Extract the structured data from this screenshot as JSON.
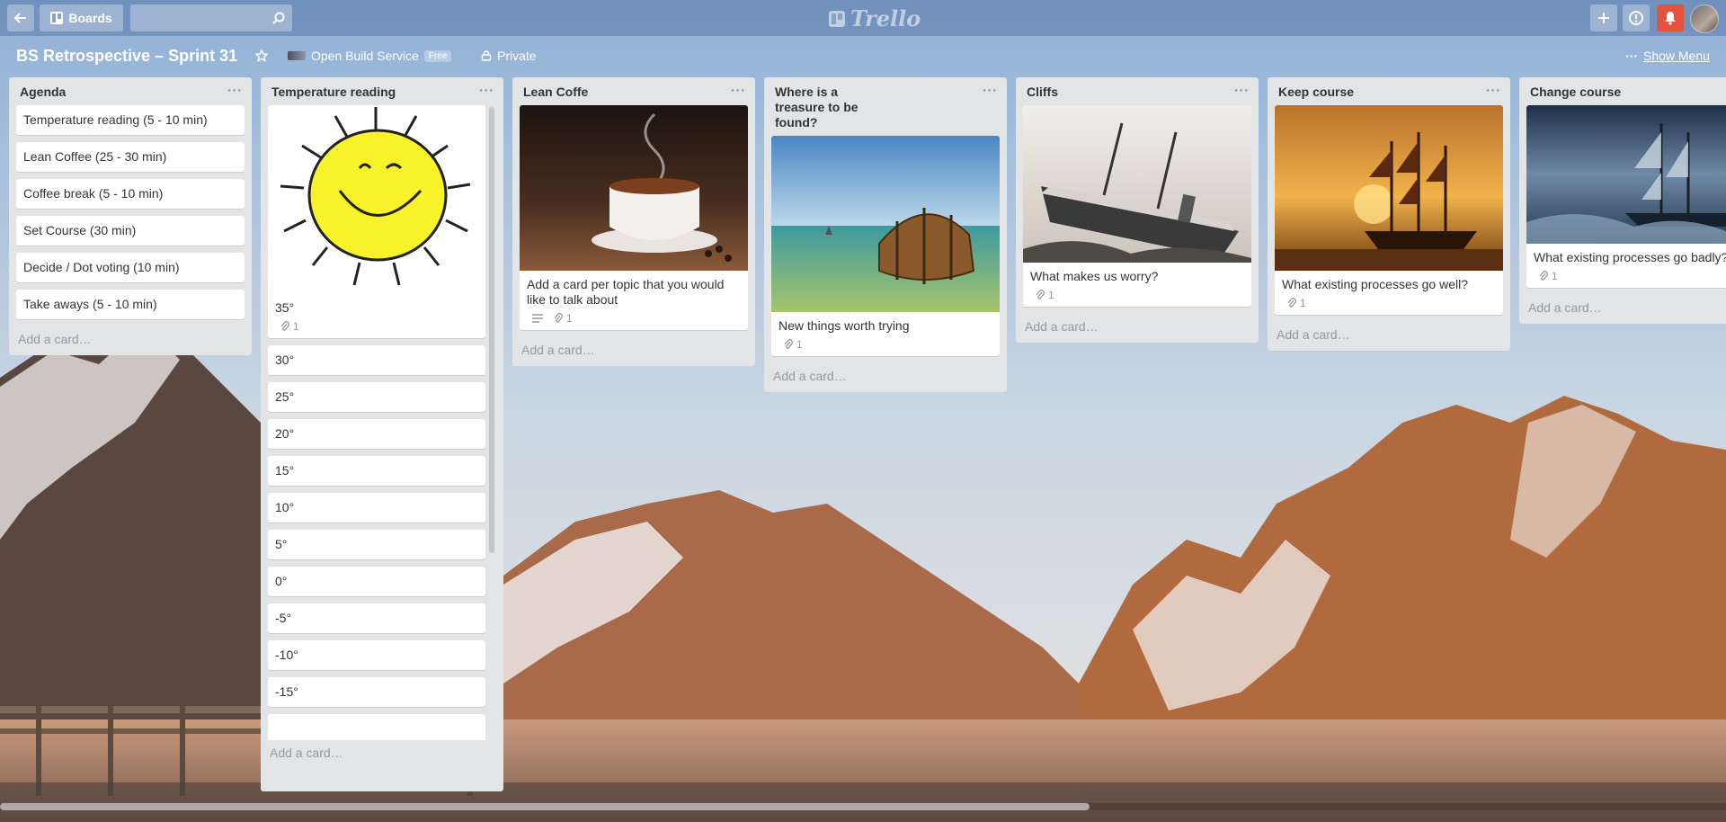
{
  "topbar": {
    "boards_label": "Boards",
    "logo_text": "Trello",
    "search_placeholder": ""
  },
  "board": {
    "title": "BS Retrospective – Sprint 31",
    "org_name": "Open Build Service",
    "org_badge": "Free",
    "visibility": "Private",
    "show_menu": "Show Menu"
  },
  "lists": {
    "agenda": {
      "title": "Agenda",
      "cards": [
        "Temperature reading (5 - 10 min)",
        "Lean Coffee (25 - 30 min)",
        "Coffee break (5 - 10 min)",
        "Set Course (30 min)",
        "Decide / Dot voting (10 min)",
        "Take aways (5 - 10 min)"
      ],
      "add": "Add a card…"
    },
    "temperature": {
      "title": "Temperature reading",
      "first_card": "35°",
      "first_card_attachments": "1",
      "cards": [
        "30°",
        "25°",
        "20°",
        "15°",
        "10°",
        "5°",
        "0°",
        "-5°",
        "-10°",
        "-15°"
      ],
      "add": "Add a card…"
    },
    "lean": {
      "title": "Lean Coffe",
      "card": "Add a card per topic that you would like to talk about",
      "attachments": "1",
      "add": "Add a card…"
    },
    "treasure": {
      "title": "Where is a treasure to be found?",
      "card": "New things worth trying",
      "attachments": "1",
      "add": "Add a card…"
    },
    "cliffs": {
      "title": "Cliffs",
      "card": "What makes us worry?",
      "attachments": "1",
      "add": "Add a card…"
    },
    "keep": {
      "title": "Keep course",
      "card": "What existing processes go well?",
      "attachments": "1",
      "add": "Add a card…"
    },
    "change": {
      "title": "Change course",
      "card": "What existing processes go badly?",
      "attachments": "1",
      "add": "Add a card…"
    }
  },
  "colors": {
    "notification_red": "#e2533d",
    "sun_yellow": "#f8f22a"
  }
}
